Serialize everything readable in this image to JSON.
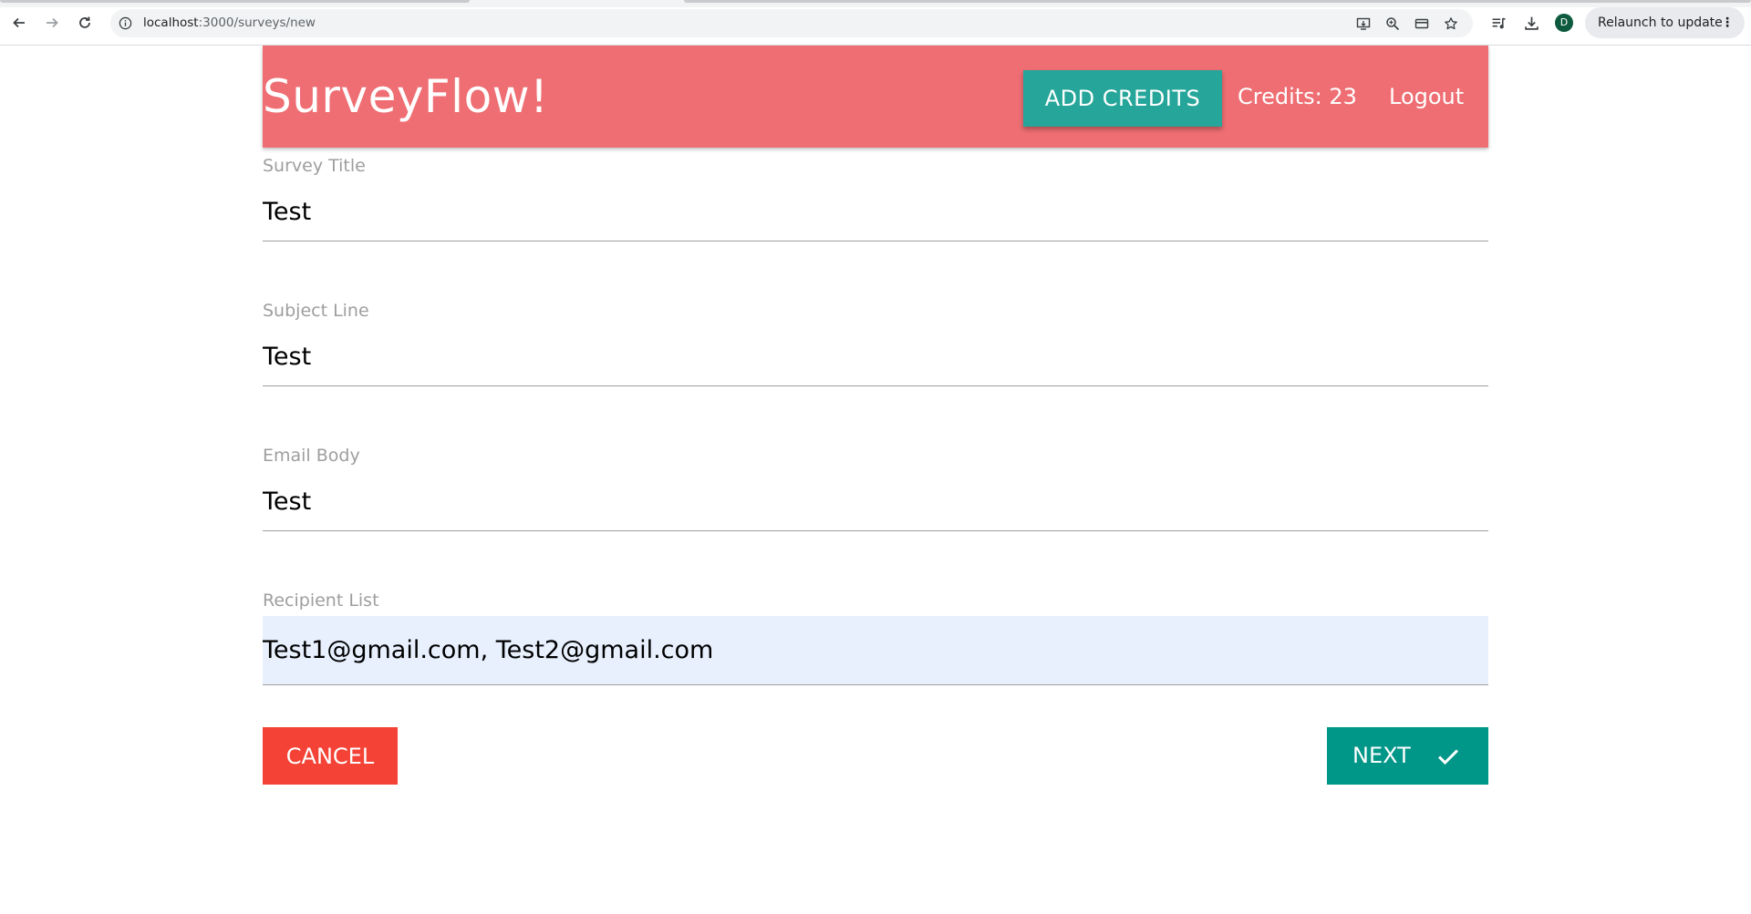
{
  "browser": {
    "url_host": "localhost",
    "url_rest": ":3000/surveys/new",
    "profile_initial": "D",
    "relaunch_label": "Relaunch to update",
    "menu_glyph": "⋮"
  },
  "navbar": {
    "brand": "SurveyFlow!",
    "add_credits_label": "ADD CREDITS",
    "credits_text": "Credits: 23",
    "logout_label": "Logout",
    "color": "#ee6e73"
  },
  "form": {
    "fields": [
      {
        "label": "Survey Title",
        "value": "Test"
      },
      {
        "label": "Subject Line",
        "value": "Test"
      },
      {
        "label": "Email Body",
        "value": "Test"
      },
      {
        "label": "Recipient List",
        "value": "Test1@gmail.com, Test2@gmail.com"
      }
    ],
    "cancel_label": "CANCEL",
    "next_label": "NEXT"
  },
  "icons": [
    "back-icon",
    "forward-icon",
    "reload-icon",
    "site-info-icon",
    "install-app-icon",
    "zoom-icon",
    "card-icon",
    "bookmark-star-icon",
    "media-queue-icon",
    "download-icon",
    "check-icon"
  ],
  "colors": {
    "accent_teal": "#26a69a",
    "next_teal": "#009688",
    "cancel_red": "#f44336"
  }
}
